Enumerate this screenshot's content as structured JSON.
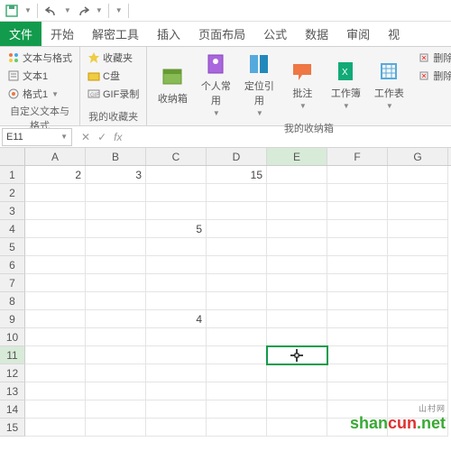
{
  "qat": {
    "save": "save",
    "undo": "undo",
    "redo": "redo"
  },
  "tabs": [
    "文件",
    "开始",
    "解密工具",
    "插入",
    "页面布局",
    "公式",
    "数据",
    "审阅",
    "视"
  ],
  "activeTab": 0,
  "ribbon": {
    "group1": {
      "label": "自定义文本与格式",
      "items": [
        "文本与格式",
        "文本1",
        "格式1"
      ]
    },
    "group2": {
      "label": "我的收藏夹",
      "items": [
        "收藏夹",
        "C盘",
        "GIF录制"
      ]
    },
    "group3": {
      "label": "我的收纳箱",
      "buttons": [
        "收纳箱",
        "个人常用",
        "定位引用",
        "批注",
        "工作簿",
        "工作表"
      ],
      "side": [
        "删除未",
        "删除选"
      ]
    }
  },
  "namebox": "E11",
  "columns": [
    "A",
    "B",
    "C",
    "D",
    "E",
    "F",
    "G"
  ],
  "rowCount": 15,
  "cells": {
    "A1": "2",
    "B1": "3",
    "D1": "15",
    "C4": "5",
    "C9": "4"
  },
  "selected": {
    "col": "E",
    "row": 11
  },
  "watermark": {
    "text1": "shan",
    "text2": "cun",
    "ext": ".net",
    "sub": "山村网"
  }
}
